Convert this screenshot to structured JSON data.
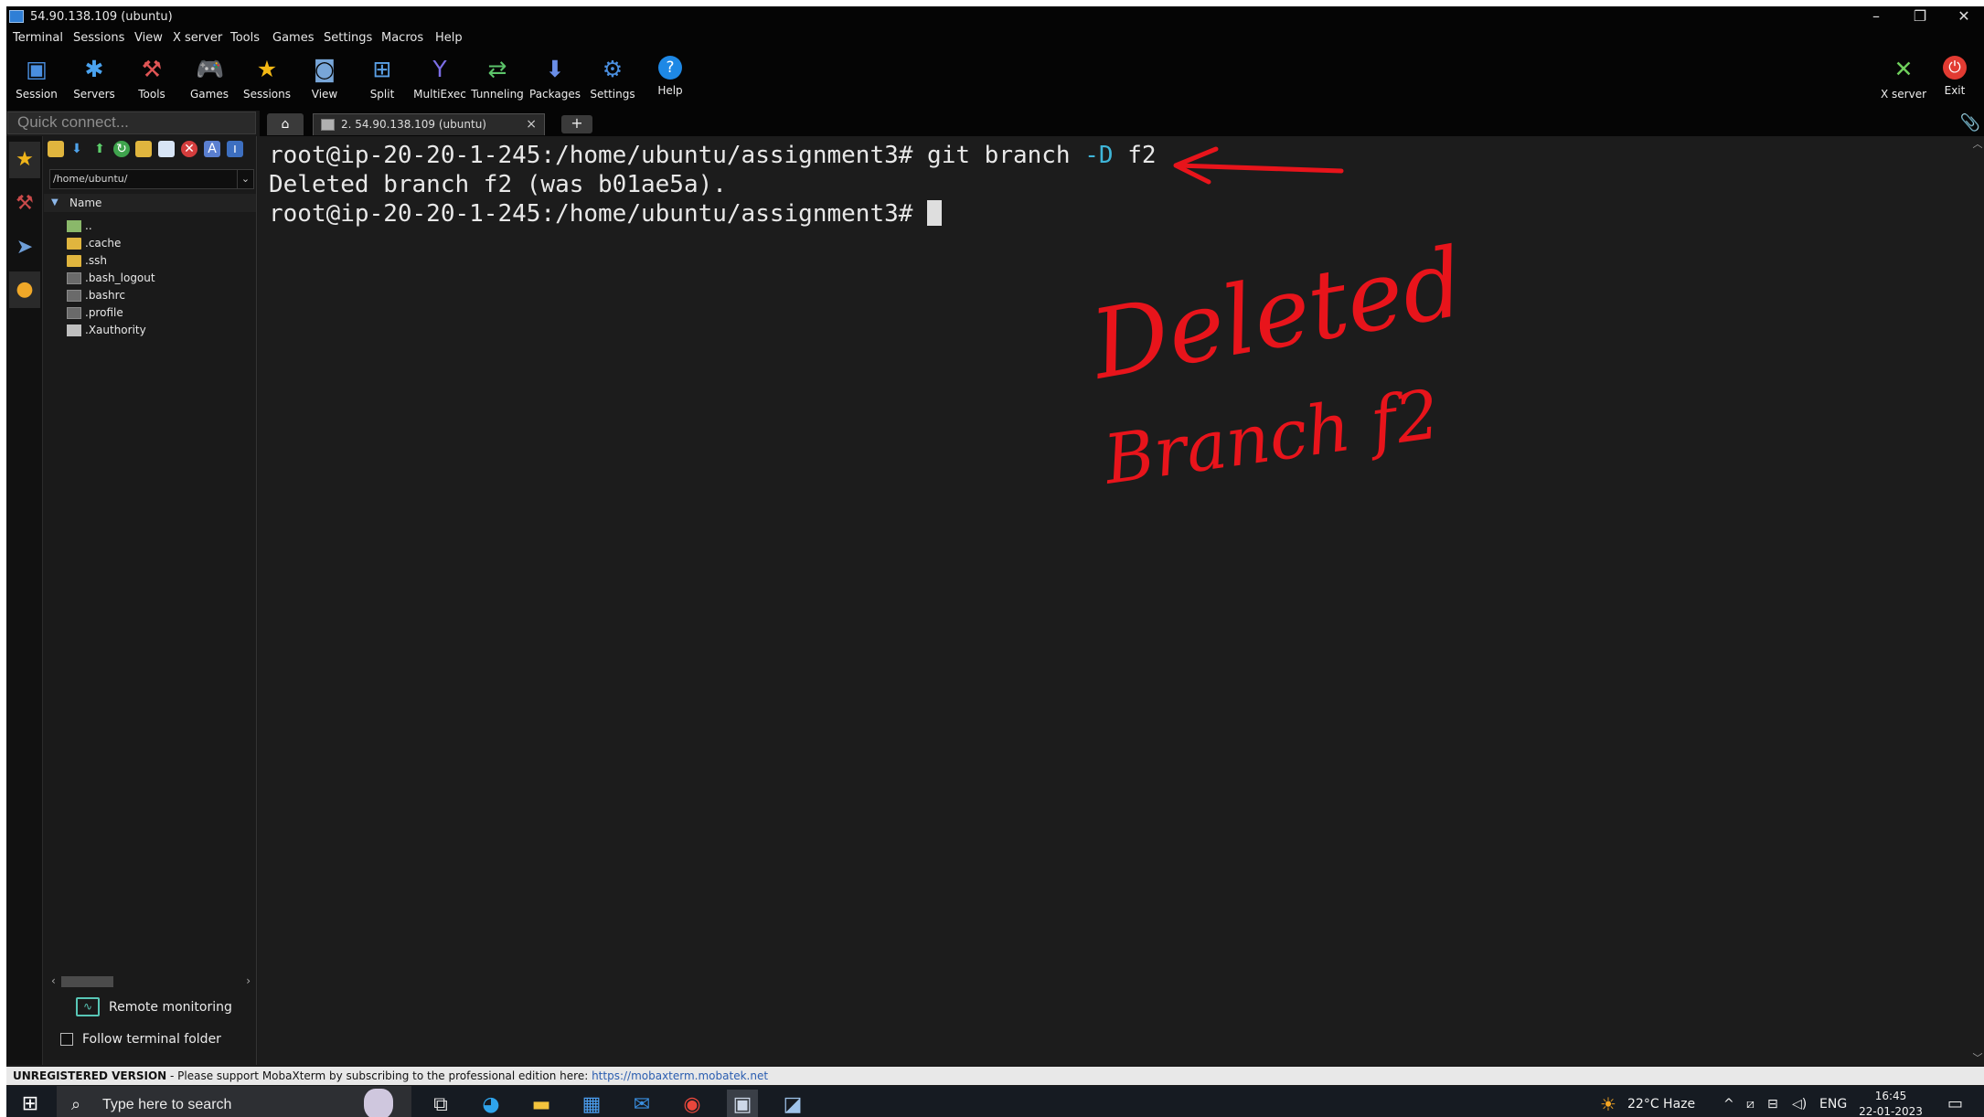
{
  "window": {
    "title": "54.90.138.109 (ubuntu)",
    "minimize": "–",
    "restore": "❐",
    "close": "✕"
  },
  "menu": [
    "Terminal",
    "Sessions",
    "View",
    "X server",
    "Tools",
    "Games",
    "Settings",
    "Macros",
    "Help"
  ],
  "toolbar": {
    "session": "Session",
    "servers": "Servers",
    "tools": "Tools",
    "games": "Games",
    "sessions": "Sessions",
    "view": "View",
    "split": "Split",
    "multiexec": "MultiExec",
    "tunneling": "Tunneling",
    "packages": "Packages",
    "settings": "Settings",
    "help": "Help",
    "xserver": "X server",
    "exit": "Exit"
  },
  "quick_connect": {
    "placeholder": "Quick connect..."
  },
  "tabs": {
    "session_label": "2. 54.90.138.109 (ubuntu)",
    "close": "×",
    "new": "+"
  },
  "sftp": {
    "path": "/home/ubuntu/",
    "column": "Name",
    "files": [
      "..",
      ".cache",
      ".ssh",
      ".bash_logout",
      ".bashrc",
      ".profile",
      ".Xauthority"
    ],
    "remote_monitoring": "Remote monitoring",
    "follow_folder": "Follow terminal folder"
  },
  "terminal": {
    "line1_prompt": "root@ip-20-20-1-245:/home/ubuntu/assignment3# git branch ",
    "line1_flag": "-D",
    "line1_arg": " f2",
    "line2": "Deleted branch f2 (was b01ae5a).",
    "line3_prompt": "root@ip-20-20-1-245:/home/ubuntu/assignment3# "
  },
  "annotation": {
    "word1": "Deleted",
    "word2": "Branch f2",
    "color": "#e8141b"
  },
  "statusbar": {
    "label": "UNREGISTERED VERSION",
    "message": " -  Please support MobaXterm by subscribing to the professional edition here:  ",
    "link": "https://mobaxterm.mobatek.net"
  },
  "taskbar": {
    "search_placeholder": "Type here to search",
    "weather": "22°C  Haze",
    "lang": "ENG",
    "time": "16:45",
    "date": "22-01-2023"
  },
  "colors": {
    "terminal_bg": "#1c1c1c",
    "flag_blue": "#3fb6d9",
    "chrome_black": "#050505"
  }
}
